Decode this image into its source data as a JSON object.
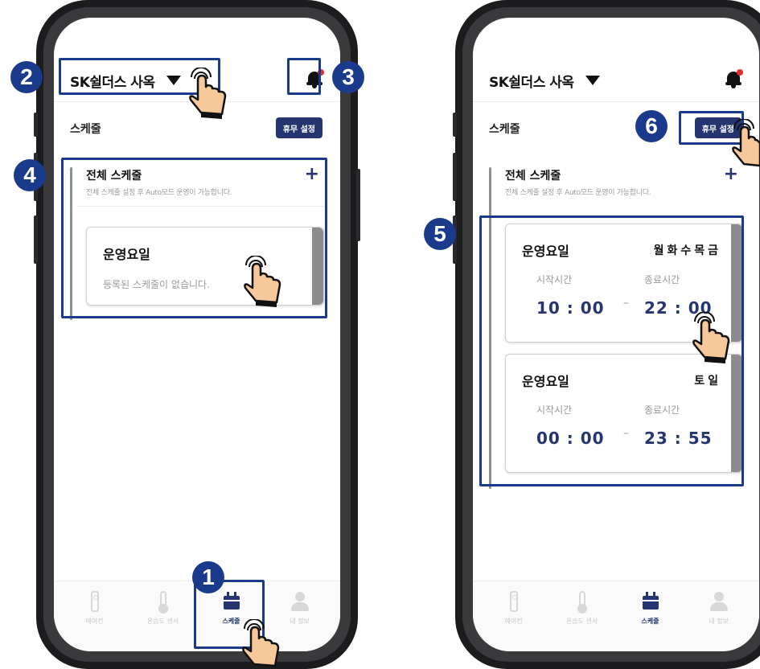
{
  "left": {
    "site_name": "SK쉴더스 사옥",
    "section_title": "스케줄",
    "vacation_button": "휴무 설정",
    "panel_title": "전체 스케줄",
    "panel_plus": "+",
    "panel_desc": "전체 스케줄 설정 후 Auto모드 운영이 가능합니다.",
    "card": {
      "title": "운영요일",
      "empty_text": "등록된 스케줄이 없습니다."
    },
    "nav": [
      "에어컨",
      "온습도 센서",
      "스케줄",
      "내 정보"
    ],
    "active_nav": 2
  },
  "right": {
    "site_name": "SK쉴더스 사옥",
    "section_title": "스케줄",
    "vacation_button": "휴무 설정",
    "panel_title": "전체 스케줄",
    "panel_plus": "+",
    "panel_desc": "전체 스케줄 설정 후 Auto모드 운영이 가능합니다.",
    "cards": [
      {
        "title": "운영요일",
        "days": "월화수목금",
        "start_label": "시작시간",
        "start": "10 : 00",
        "dash": "–",
        "end_label": "종료시간",
        "end": "22 : 00"
      },
      {
        "title": "운영요일",
        "days": "토일",
        "start_label": "시작시간",
        "start": "00 : 00",
        "dash": "–",
        "end_label": "종료시간",
        "end": "23 : 55"
      }
    ],
    "nav": [
      "에어컨",
      "온습도 센서",
      "스케줄",
      "내 정보"
    ],
    "active_nav": 2
  },
  "badges": [
    "1",
    "2",
    "3",
    "4",
    "5",
    "6"
  ],
  "colors": {
    "accent": "#243570",
    "highlight": "#1a3a8c",
    "notification_dot": "#e12d2d"
  }
}
